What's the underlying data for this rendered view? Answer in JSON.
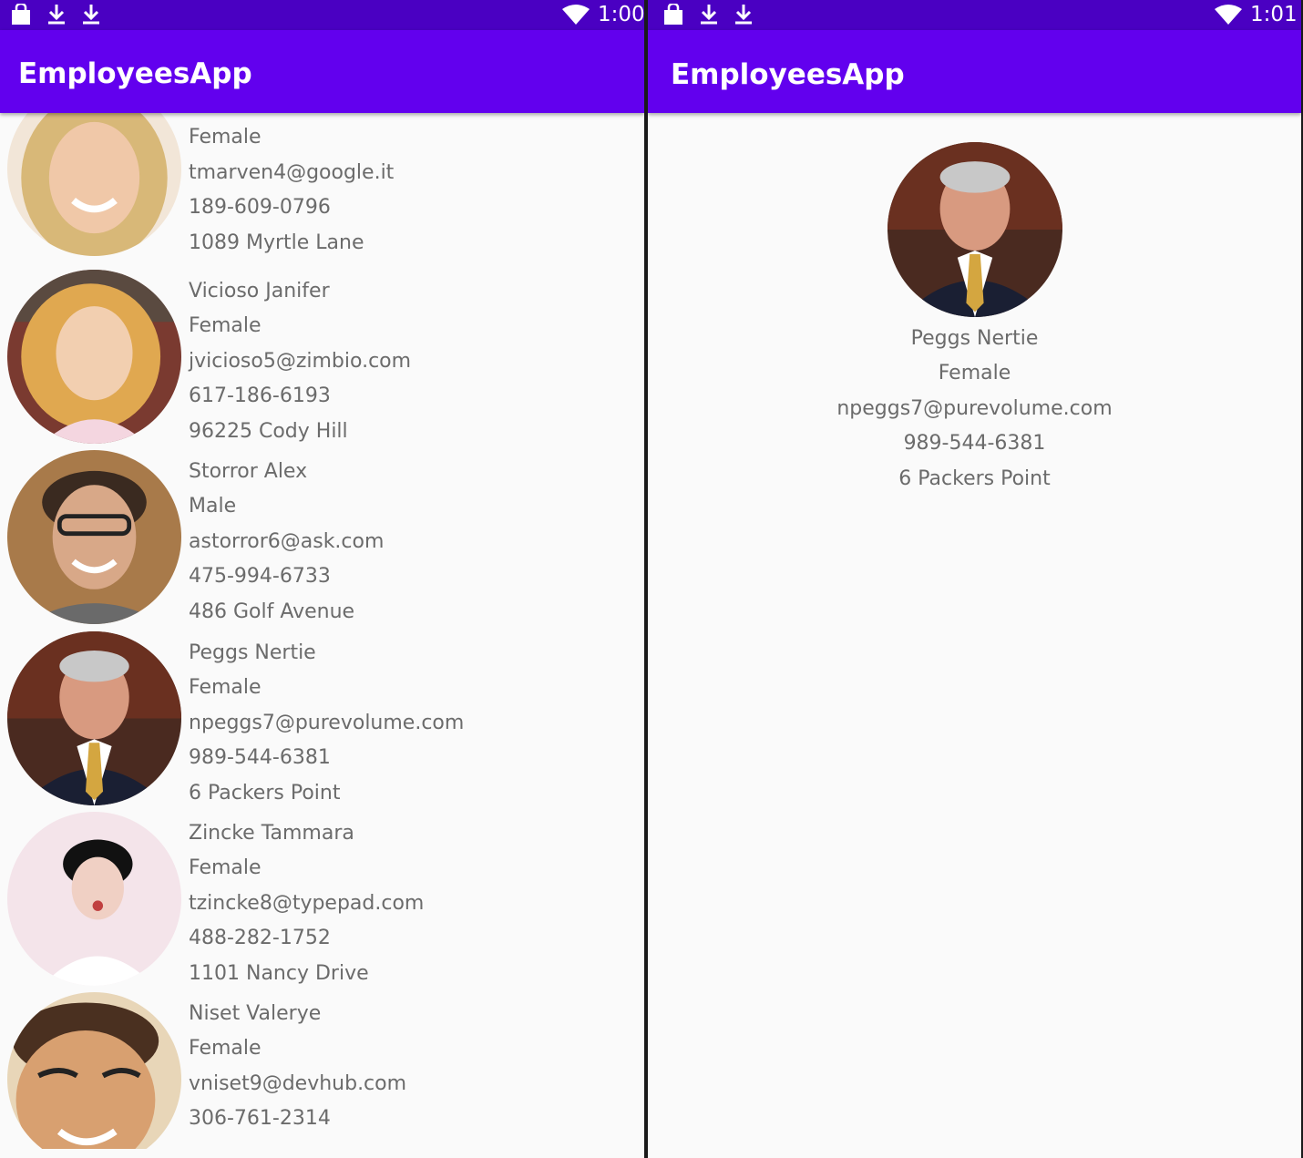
{
  "left_screen": {
    "status_time": "1:00",
    "app_title": "EmployeesApp",
    "employees": [
      {
        "name": "",
        "gender": "Female",
        "email": "tmarven4@google.it",
        "phone": "189-609-0796",
        "address": "1089 Myrtle Lane"
      },
      {
        "name": "Vicioso Janifer",
        "gender": "Female",
        "email": "jvicioso5@zimbio.com",
        "phone": "617-186-6193",
        "address": "96225 Cody Hill"
      },
      {
        "name": "Storror Alex",
        "gender": "Male",
        "email": "astorror6@ask.com",
        "phone": "475-994-6733",
        "address": "486 Golf Avenue"
      },
      {
        "name": "Peggs Nertie",
        "gender": "Female",
        "email": "npeggs7@purevolume.com",
        "phone": "989-544-6381",
        "address": "6 Packers Point"
      },
      {
        "name": "Zincke Tammara",
        "gender": "Female",
        "email": "tzincke8@typepad.com",
        "phone": "488-282-1752",
        "address": "1101 Nancy Drive"
      },
      {
        "name": "Niset Valerye",
        "gender": "Female",
        "email": "vniset9@devhub.com",
        "phone": "306-761-2314",
        "address": ""
      }
    ]
  },
  "right_screen": {
    "status_time": "1:01",
    "app_title": "EmployeesApp",
    "detail": {
      "name": "Peggs Nertie",
      "gender": "Female",
      "email": "npeggs7@purevolume.com",
      "phone": "989-544-6381",
      "address": "6 Packers Point"
    }
  },
  "icons": [
    "shopping-bag-icon",
    "download-icon",
    "download-icon",
    "wifi-icon"
  ],
  "colors": {
    "status_bar": "#4a00c2",
    "app_bar": "#6200ee",
    "background": "#fafafa",
    "text": "#6b6b6b"
  }
}
